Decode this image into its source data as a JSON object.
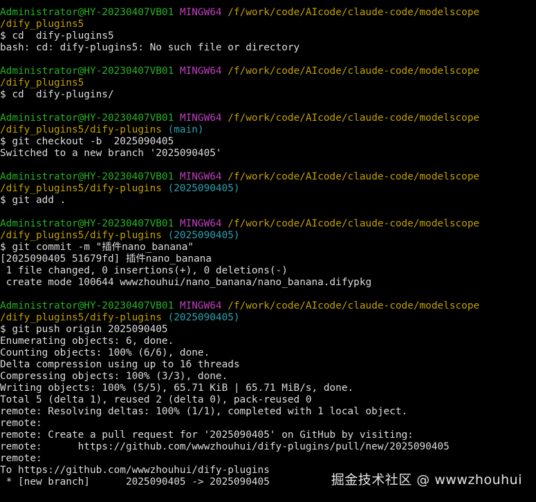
{
  "colors": {
    "background": "#000000",
    "user_host": "#26b226",
    "msystem": "#bf3fbf",
    "path": "#c2a000",
    "branch": "#2aa3b4",
    "output": "#dddddd"
  },
  "blocks": [
    {
      "user": "Administrator@HY-20230407VB01",
      "msystem": "MINGW64",
      "path": "/f/work/code/AIcode/claude-code/modelscope",
      "path2": "/dify_plugins5",
      "branch": "",
      "command": "$ cd  dify-plugins5",
      "output": [
        "bash: cd: dify-plugins5: No such file or directory"
      ]
    },
    {
      "user": "Administrator@HY-20230407VB01",
      "msystem": "MINGW64",
      "path": "/f/work/code/AIcode/claude-code/modelscope",
      "path2": "/dify_plugins5",
      "branch": "",
      "command": "$ cd  dify-plugins/",
      "output": []
    },
    {
      "user": "Administrator@HY-20230407VB01",
      "msystem": "MINGW64",
      "path": "/f/work/code/AIcode/claude-code/modelscope",
      "path2": "/dify_plugins5/dify-plugins",
      "branch": "(main)",
      "command": "$ git checkout -b  2025090405",
      "output": [
        "Switched to a new branch '2025090405'"
      ]
    },
    {
      "user": "Administrator@HY-20230407VB01",
      "msystem": "MINGW64",
      "path": "/f/work/code/AIcode/claude-code/modelscope",
      "path2": "/dify_plugins5/dify-plugins",
      "branch": "(2025090405)",
      "command": "$ git add .",
      "output": []
    },
    {
      "user": "Administrator@HY-20230407VB01",
      "msystem": "MINGW64",
      "path": "/f/work/code/AIcode/claude-code/modelscope",
      "path2": "/dify_plugins5/dify-plugins",
      "branch": "(2025090405)",
      "command": "$ git commit -m \"插件nano_banana\"",
      "output": [
        "[2025090405 51679fd] 插件nano_banana",
        " 1 file changed, 0 insertions(+), 0 deletions(-)",
        " create mode 100644 wwwzhouhui/nano_banana/nano_banana.difypkg"
      ]
    },
    {
      "user": "Administrator@HY-20230407VB01",
      "msystem": "MINGW64",
      "path": "/f/work/code/AIcode/claude-code/modelscope",
      "path2": "/dify_plugins5/dify-plugins",
      "branch": "(2025090405)",
      "command": "$ git push origin 2025090405",
      "output": [
        "Enumerating objects: 6, done.",
        "Counting objects: 100% (6/6), done.",
        "Delta compression using up to 16 threads",
        "Compressing objects: 100% (3/3), done.",
        "Writing objects: 100% (5/5), 65.71 KiB | 65.71 MiB/s, done.",
        "Total 5 (delta 1), reused 2 (delta 0), pack-reused 0",
        "remote: Resolving deltas: 100% (1/1), completed with 1 local object.",
        "remote:",
        "remote: Create a pull request for '2025090405' on GitHub by visiting:",
        "remote:      https://github.com/wwwzhouhui/dify-plugins/pull/new/2025090405",
        "remote:",
        "To https://github.com/wwwzhouhui/dify-plugins",
        " * [new branch]      2025090405 -> 2025090405"
      ]
    }
  ],
  "watermark": "掘金技术社区 @ wwwzhouhui"
}
